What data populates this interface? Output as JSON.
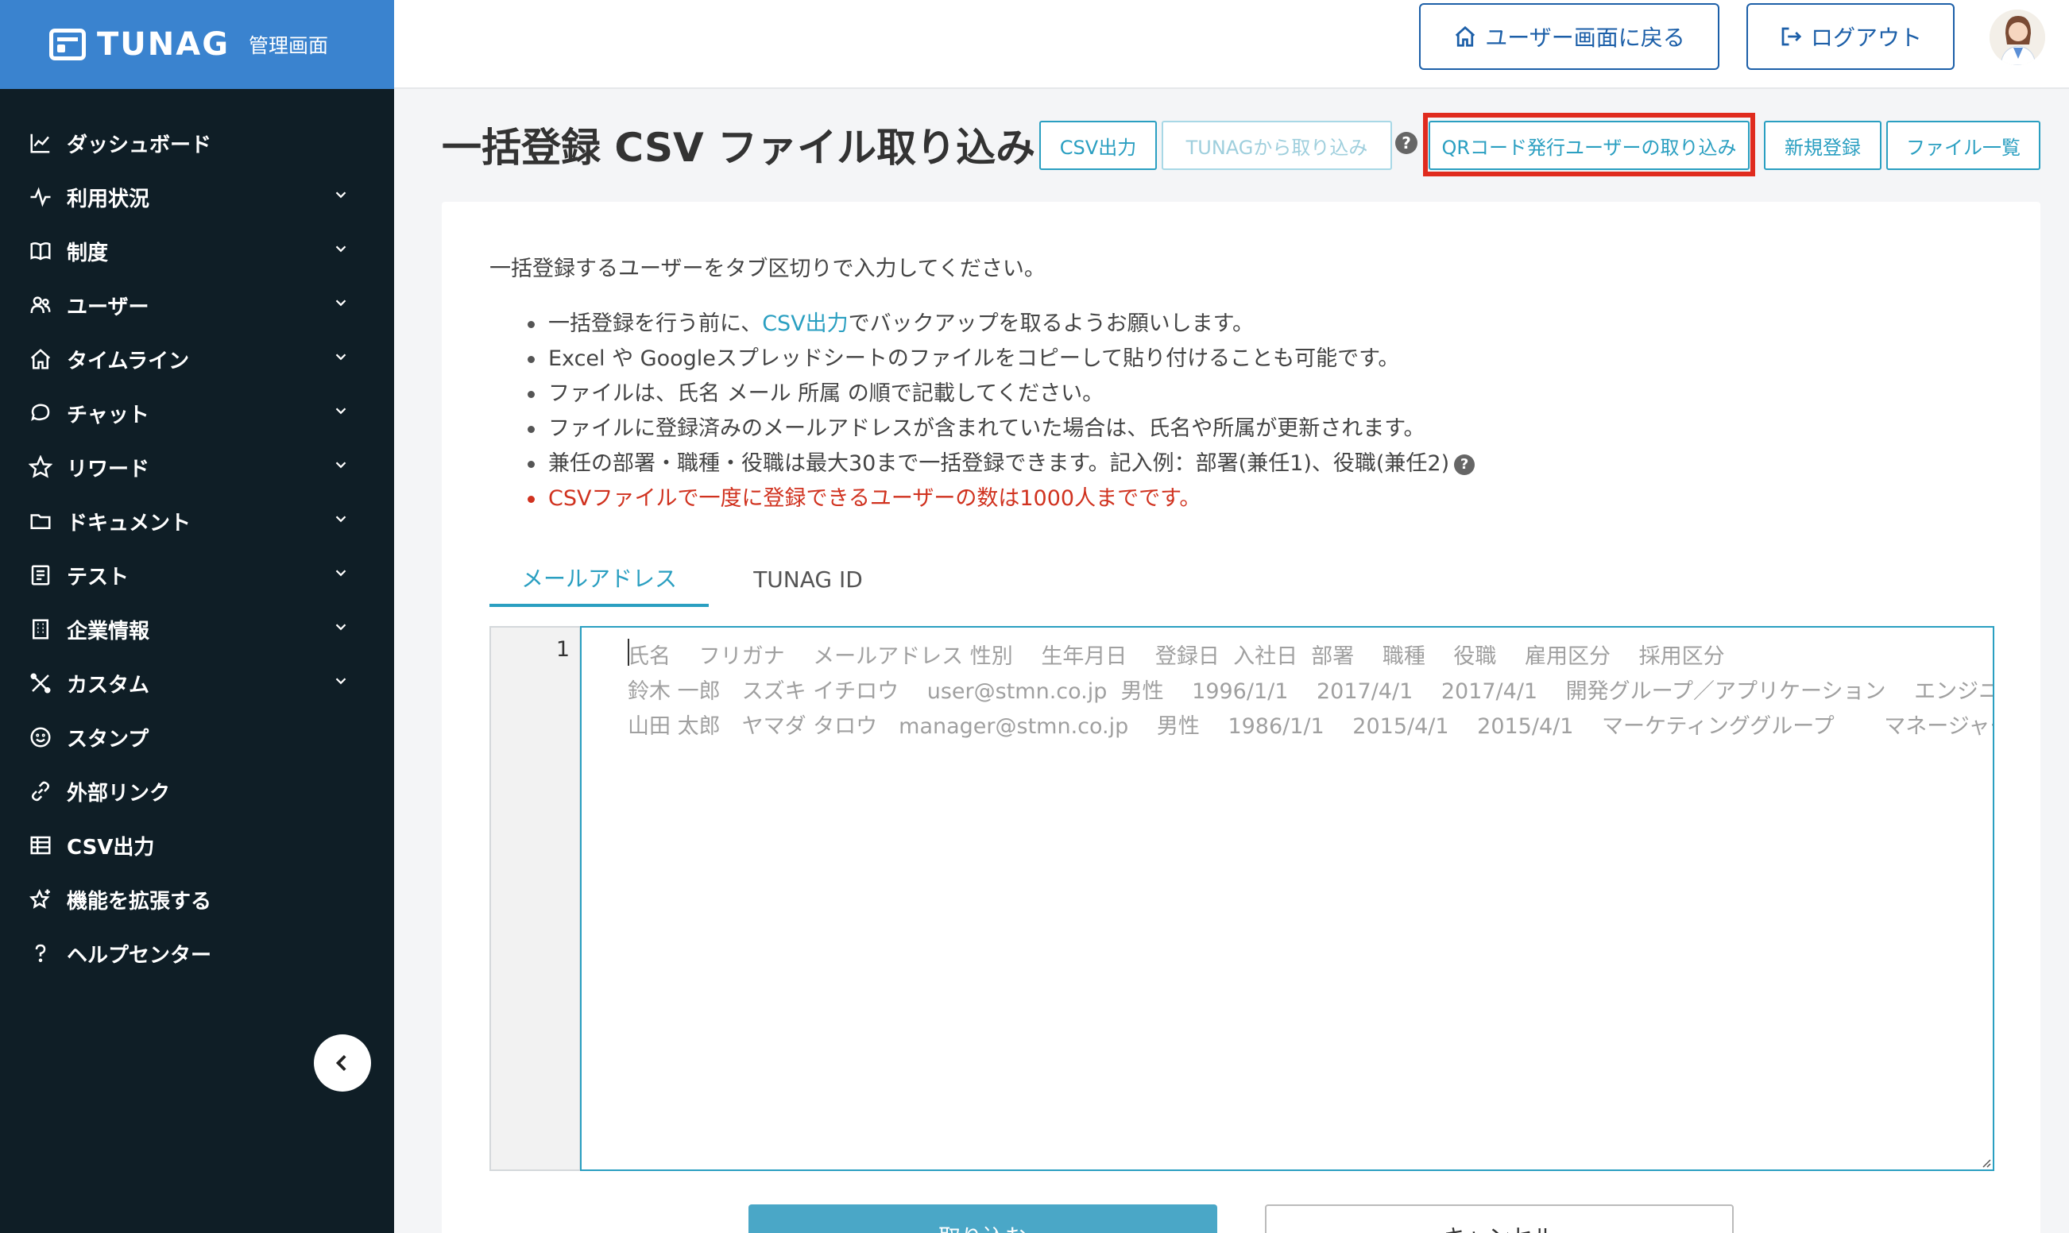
{
  "brand": {
    "name": "TUNAG",
    "sub": "管理画面"
  },
  "sidebar": {
    "items": [
      {
        "label": "ダッシュボード",
        "icon": "chart-icon",
        "expandable": false
      },
      {
        "label": "利用状況",
        "icon": "pulse-icon",
        "expandable": true
      },
      {
        "label": "制度",
        "icon": "book-icon",
        "expandable": true
      },
      {
        "label": "ユーザー",
        "icon": "users-icon",
        "expandable": true
      },
      {
        "label": "タイムライン",
        "icon": "home-icon",
        "expandable": true
      },
      {
        "label": "チャット",
        "icon": "chat-icon",
        "expandable": true
      },
      {
        "label": "リワード",
        "icon": "star-icon",
        "expandable": true
      },
      {
        "label": "ドキュメント",
        "icon": "folder-icon",
        "expandable": true
      },
      {
        "label": "テスト",
        "icon": "checklist-icon",
        "expandable": true
      },
      {
        "label": "企業情報",
        "icon": "building-icon",
        "expandable": true
      },
      {
        "label": "カスタム",
        "icon": "tools-icon",
        "expandable": true
      },
      {
        "label": "スタンプ",
        "icon": "smile-icon",
        "expandable": false
      },
      {
        "label": "外部リンク",
        "icon": "link-icon",
        "expandable": false
      },
      {
        "label": "CSV出力",
        "icon": "table-icon",
        "expandable": false
      },
      {
        "label": "機能を拡張する",
        "icon": "star-plus-icon",
        "expandable": false
      },
      {
        "label": "ヘルプセンター",
        "icon": "question-icon",
        "expandable": false
      }
    ]
  },
  "header": {
    "back_label": "ユーザー画面に戻る",
    "logout_label": "ログアウト"
  },
  "page": {
    "title": "一括登録 CSV ファイル取り込み",
    "buttons": {
      "csv_export": "CSV出力",
      "tunag_import": "TUNAGから取り込み",
      "qr_import": "QRコード発行ユーザーの取り込み",
      "new_register": "新規登録",
      "file_list": "ファイル一覧"
    }
  },
  "instructions": {
    "intro": "一括登録するユーザーをタブ区切りで入力してください。",
    "b1_pre": "一括登録を行う前に、",
    "b1_link": "CSV出力",
    "b1_post": "でバックアップを取るようお願いします。",
    "b2": "Excel や Googleスプレッドシートのファイルをコピーして貼り付けることも可能です。",
    "b3": "ファイルは、氏名 メール 所属 の順で記載してください。",
    "b4": "ファイルに登録済みのメールアドレスが含まれていた場合は、氏名や所属が更新されます。",
    "b5": "兼任の部署・職種・役職は最大30まで一括登録できます。記入例：部署(兼任1)、役職(兼任2)",
    "b6": "CSVファイルで一度に登録できるユーザーの数は1000人までです。"
  },
  "tabs": {
    "email": "メールアドレス",
    "tunag_id": "TUNAG ID"
  },
  "editor": {
    "line_number": "1",
    "placeholder_lines": [
      "氏名　 フリガナ　 メールアドレス 性別　 生年月日　 登録日  入社日  部署　 職種　 役職　 雇用区分　 採用区分",
      "鈴木 一郎　スズキ イチロウ　 user@stmn.co.jp  男性　 1996/1/1　 2017/4/1　 2017/4/1　 開発グループ／アプリケーション　 エンジニア",
      "山田 太郎　ヤマダ タロウ　manager@stmn.co.jp　 男性　 1986/1/1　 2015/4/1　 2015/4/1　 マーケティンググループ　　 マネージャー"
    ]
  },
  "actions": {
    "import_label": "取り込む",
    "cancel_label": "キャンセル"
  }
}
